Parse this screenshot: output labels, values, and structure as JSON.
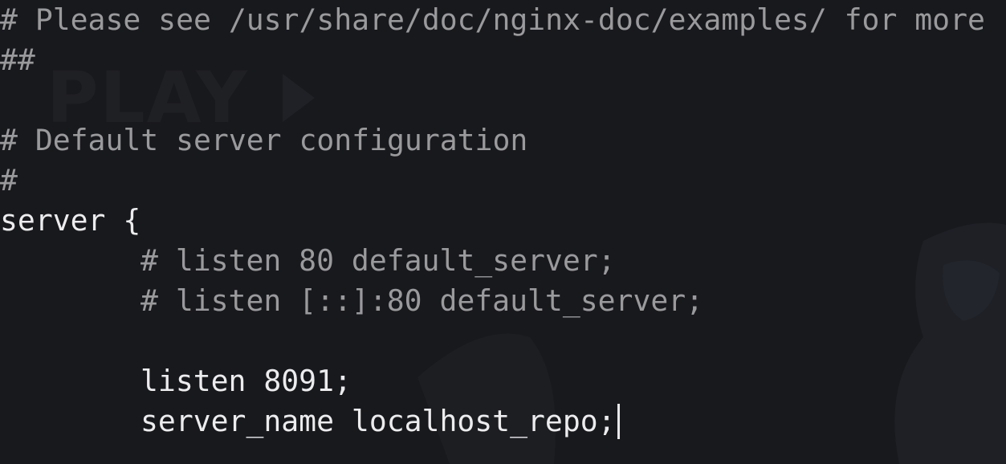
{
  "editor": {
    "lines": [
      {
        "text": "# Please see /usr/share/doc/nginx-doc/examples/ for more",
        "kind": "comment",
        "indent": false
      },
      {
        "text": "##",
        "kind": "comment",
        "indent": false
      },
      {
        "text": "",
        "kind": "blank",
        "indent": false
      },
      {
        "text": "# Default server configuration",
        "kind": "comment",
        "indent": false
      },
      {
        "text": "#",
        "kind": "comment",
        "indent": false
      },
      {
        "text": "server {",
        "kind": "code",
        "indent": false
      },
      {
        "text": "# listen 80 default_server;",
        "kind": "comment",
        "indent": true
      },
      {
        "text": "# listen [::]:80 default_server;",
        "kind": "comment",
        "indent": true
      },
      {
        "text": "",
        "kind": "blank",
        "indent": false
      },
      {
        "text": "listen 8091;",
        "kind": "code",
        "indent": true
      },
      {
        "text": "server_name localhost_repo;",
        "kind": "code",
        "indent": true
      }
    ],
    "cursor_line": 10
  },
  "wallpaper": {
    "logo_text": "PLAY"
  },
  "colors": {
    "background": "#18191d",
    "comment": "#9a9a9d",
    "code": "#ececee"
  }
}
